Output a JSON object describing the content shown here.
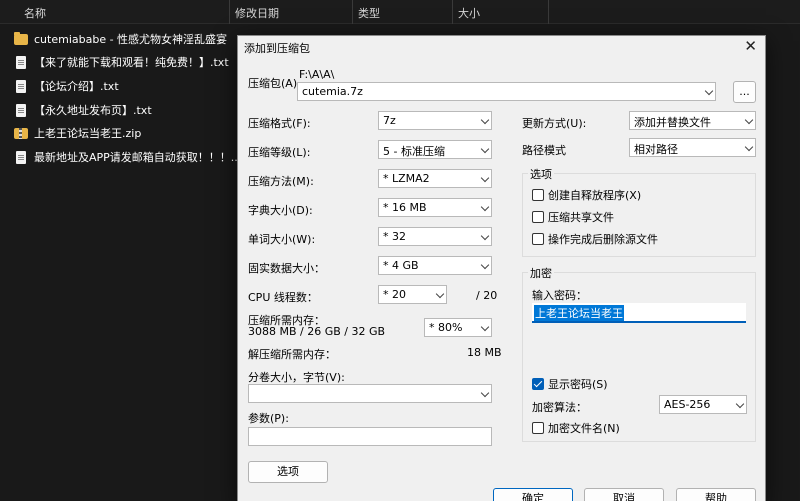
{
  "explorer": {
    "columns": [
      "名称",
      "修改日期",
      "类型",
      "大小"
    ],
    "files": [
      {
        "icon": "folder-icon",
        "name": "cutemiababe - 性感尤物女神淫乱盛宴"
      },
      {
        "icon": "text-file-icon",
        "name": "【来了就能下载和观看！纯免费！】.txt"
      },
      {
        "icon": "text-file-icon",
        "name": "【论坛介绍】.txt"
      },
      {
        "icon": "text-file-icon",
        "name": "【永久地址发布页】.txt"
      },
      {
        "icon": "zip-icon",
        "name": "上老王论坛当老王.zip"
      },
      {
        "icon": "text-file-icon",
        "name": "最新地址及APP请发邮箱自动获取！！！...."
      }
    ]
  },
  "dialog": {
    "title": "添加到压缩包",
    "close": "✕",
    "archive_label": "压缩包(A)",
    "archive_path": "F:\\A\\A\\",
    "archive_name": "cutemia.7z",
    "browse_label": "...",
    "left": {
      "format_label": "压缩格式(F):",
      "format_value": "7z",
      "level_label": "压缩等级(L):",
      "level_value": "5 - 标准压缩",
      "method_label": "压缩方法(M):",
      "method_value": "*  LZMA2",
      "dict_label": "字典大小(D):",
      "dict_value": "*  16 MB",
      "word_label": "单词大小(W):",
      "word_value": "*  32",
      "solid_label": "固实数据大小：",
      "solid_value": "*  4 GB",
      "cpu_label": "CPU 线程数：",
      "cpu_value": "*  20",
      "cpu_max": "/ 20",
      "mem_label": "压缩所需内存：",
      "mem_detail": "3088 MB / 26 GB / 32 GB",
      "mem_value": "* 80%",
      "decomp_label": "解压缩所需内存：",
      "decomp_value": "18 MB",
      "split_label": "分卷大小，字节(V):",
      "split_value": "",
      "params_label": "参数(P):",
      "params_value": "",
      "options_button": "选项"
    },
    "right": {
      "update_label": "更新方式(U):",
      "update_value": "添加并替换文件",
      "path_label": "路径模式",
      "path_value": "相对路径",
      "options_group": "选项",
      "opt_sfx": "创建自释放程序(X)",
      "opt_shared": "压缩共享文件",
      "opt_delete": "操作完成后删除源文件",
      "encrypt_group": "加密",
      "password_label": "输入密码：",
      "password_value": "上老王论坛当老王",
      "show_password": "显示密码(S)",
      "enc_method_label": "加密算法：",
      "enc_method_value": "AES-256",
      "encrypt_names": "加密文件名(N)"
    },
    "buttons": {
      "ok": "确定",
      "cancel": "取消",
      "help": "帮助"
    }
  }
}
